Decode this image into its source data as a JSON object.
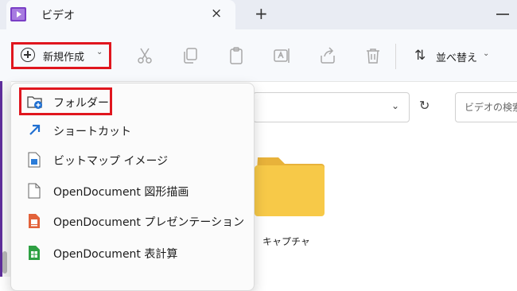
{
  "window": {
    "tab_title": "ビデオ",
    "tab_close": "×",
    "new_tab": "+"
  },
  "toolbar": {
    "new_label": "新規作成",
    "new_chevron": "⌄",
    "sort_label": "並べ替え",
    "sort_chevron": "⌄",
    "icons": [
      "cut-icon",
      "copy-icon",
      "paste-icon",
      "rename-icon",
      "share-icon",
      "delete-icon"
    ]
  },
  "address": {
    "dropdown": "⌄",
    "refresh": "↻",
    "search_placeholder": "ビデオの検索"
  },
  "menu": {
    "items": [
      {
        "label": "フォルダー",
        "icon": "new-folder-icon"
      },
      {
        "label": "ショートカット",
        "icon": "shortcut-icon"
      },
      {
        "label": "ビットマップ イメージ",
        "icon": "bitmap-image-icon"
      },
      {
        "label": "OpenDocument 図形描画",
        "icon": "document-icon"
      },
      {
        "label": "OpenDocument プレゼンテーション",
        "icon": "presentation-icon"
      },
      {
        "label": "OpenDocument 表計算",
        "icon": "spreadsheet-icon"
      }
    ]
  },
  "content": {
    "folder_label": "キャプチャ"
  },
  "colors": {
    "highlight_red": "#e0161e",
    "folder_yellow": "#f7c948",
    "accent_purple": "#5f2e9b"
  }
}
